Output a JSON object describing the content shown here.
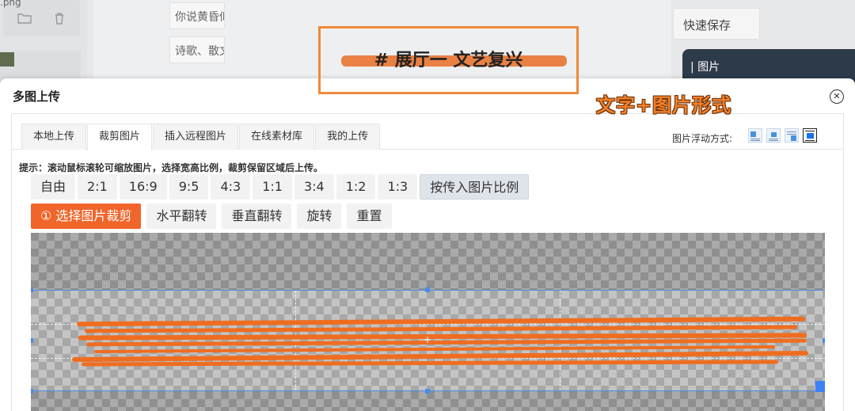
{
  "background": {
    "file_label": ".png",
    "snippets": [
      "你说黄昏似",
      "诗歌、散文"
    ],
    "title": "# 展厅一 文艺复兴",
    "quick_save": "快速保存",
    "dark_tab": "| 图片"
  },
  "annotation": "文字+图片形式",
  "modal": {
    "title": "多图上传",
    "close_icon": "close-icon",
    "tabs": [
      {
        "label": "本地上传",
        "active": false
      },
      {
        "label": "裁剪图片",
        "active": true
      },
      {
        "label": "插入远程图片",
        "active": false
      },
      {
        "label": "在线素材库",
        "active": false
      },
      {
        "label": "我的上传",
        "active": false
      }
    ],
    "float_label": "图片浮动方式:",
    "float_options": [
      "float-left-icon",
      "float-center-icon",
      "float-right-icon",
      "float-none-icon"
    ],
    "tip": "提示：滚动鼠标滚轮可缩放图片，选择宽高比例，裁剪保留区域后上传。",
    "ratios": [
      "自由",
      "2:1",
      "16:9",
      "9:5",
      "4:3",
      "1:1",
      "3:4",
      "1:2",
      "1:3",
      "按传入图片比例"
    ],
    "actions": [
      "① 选择图片裁剪",
      "水平翻转",
      "垂直翻转",
      "旋转",
      "重置"
    ],
    "colors": {
      "primary": "#f0652a",
      "crop_border": "#4a8ce8",
      "brush": "#ef6d20"
    }
  }
}
